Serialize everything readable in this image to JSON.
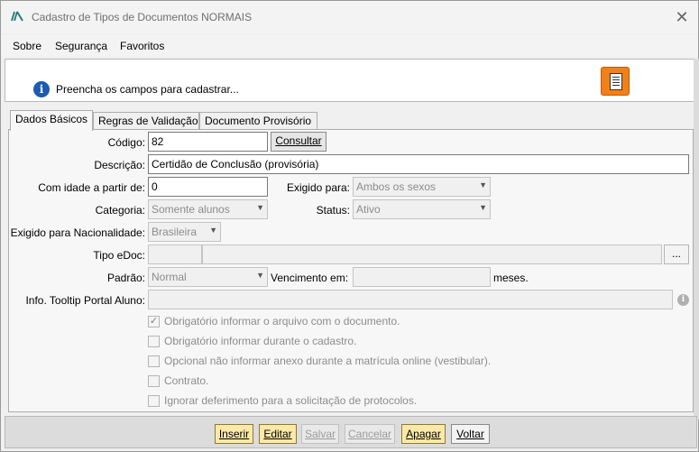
{
  "window": {
    "title": "Cadastro de Tipos de Documentos NORMAIS",
    "close": "✕"
  },
  "menu": {
    "items": [
      "Sobre",
      "Segurança",
      "Favoritos"
    ]
  },
  "info": {
    "icon_text": "i",
    "message": "Preencha os campos para cadastrar..."
  },
  "tabs": [
    "Dados Básicos",
    "Regras de Validação",
    "Documento Provisório"
  ],
  "form": {
    "codigo": {
      "label": "Código:",
      "value": "82",
      "button": "Consultar"
    },
    "descricao": {
      "label": "Descrição:",
      "value": "Certidão de Conclusão (provisória)"
    },
    "com_idade": {
      "label": "Com idade a partir de:",
      "value": "0"
    },
    "exigido_para": {
      "label": "Exigido para:",
      "value": "Ambos os sexos"
    },
    "categoria": {
      "label": "Categoria:",
      "value": "Somente alunos"
    },
    "status": {
      "label": "Status:",
      "value": "Ativo"
    },
    "nacionalidade": {
      "label": "Exigido para Nacionalidade:",
      "value": "Brasileira"
    },
    "tipo_edoc": {
      "label": "Tipo eDoc:",
      "code": "",
      "value": "",
      "button": "..."
    },
    "padrao": {
      "label": "Padrão:",
      "value": "Normal"
    },
    "vencimento": {
      "label": "Vencimento em:",
      "value": "",
      "suffix": "meses."
    },
    "tooltip": {
      "label": "Info. Tooltip Portal Aluno:",
      "value": "",
      "icon_text": "i"
    }
  },
  "checkboxes": [
    {
      "label": "Obrigatório informar o arquivo com o documento.",
      "checked": true
    },
    {
      "label": "Obrigatório informar durante o cadastro.",
      "checked": false
    },
    {
      "label": "Opcional não informar anexo durante a matrícula online (vestibular).",
      "checked": false
    },
    {
      "label": "Contrato.",
      "checked": false
    },
    {
      "label": "Ignorar deferimento para a solicitação de protocolos.",
      "checked": false
    }
  ],
  "actions": {
    "inserir": "Inserir",
    "editar": "Editar",
    "salvar": "Salvar",
    "cancelar": "Cancelar",
    "apagar": "Apagar",
    "voltar": "Voltar"
  },
  "colors": {
    "accent_orange": "#f0801a",
    "info_blue": "#1c5bb3",
    "active_button": "#fbe9a8"
  }
}
